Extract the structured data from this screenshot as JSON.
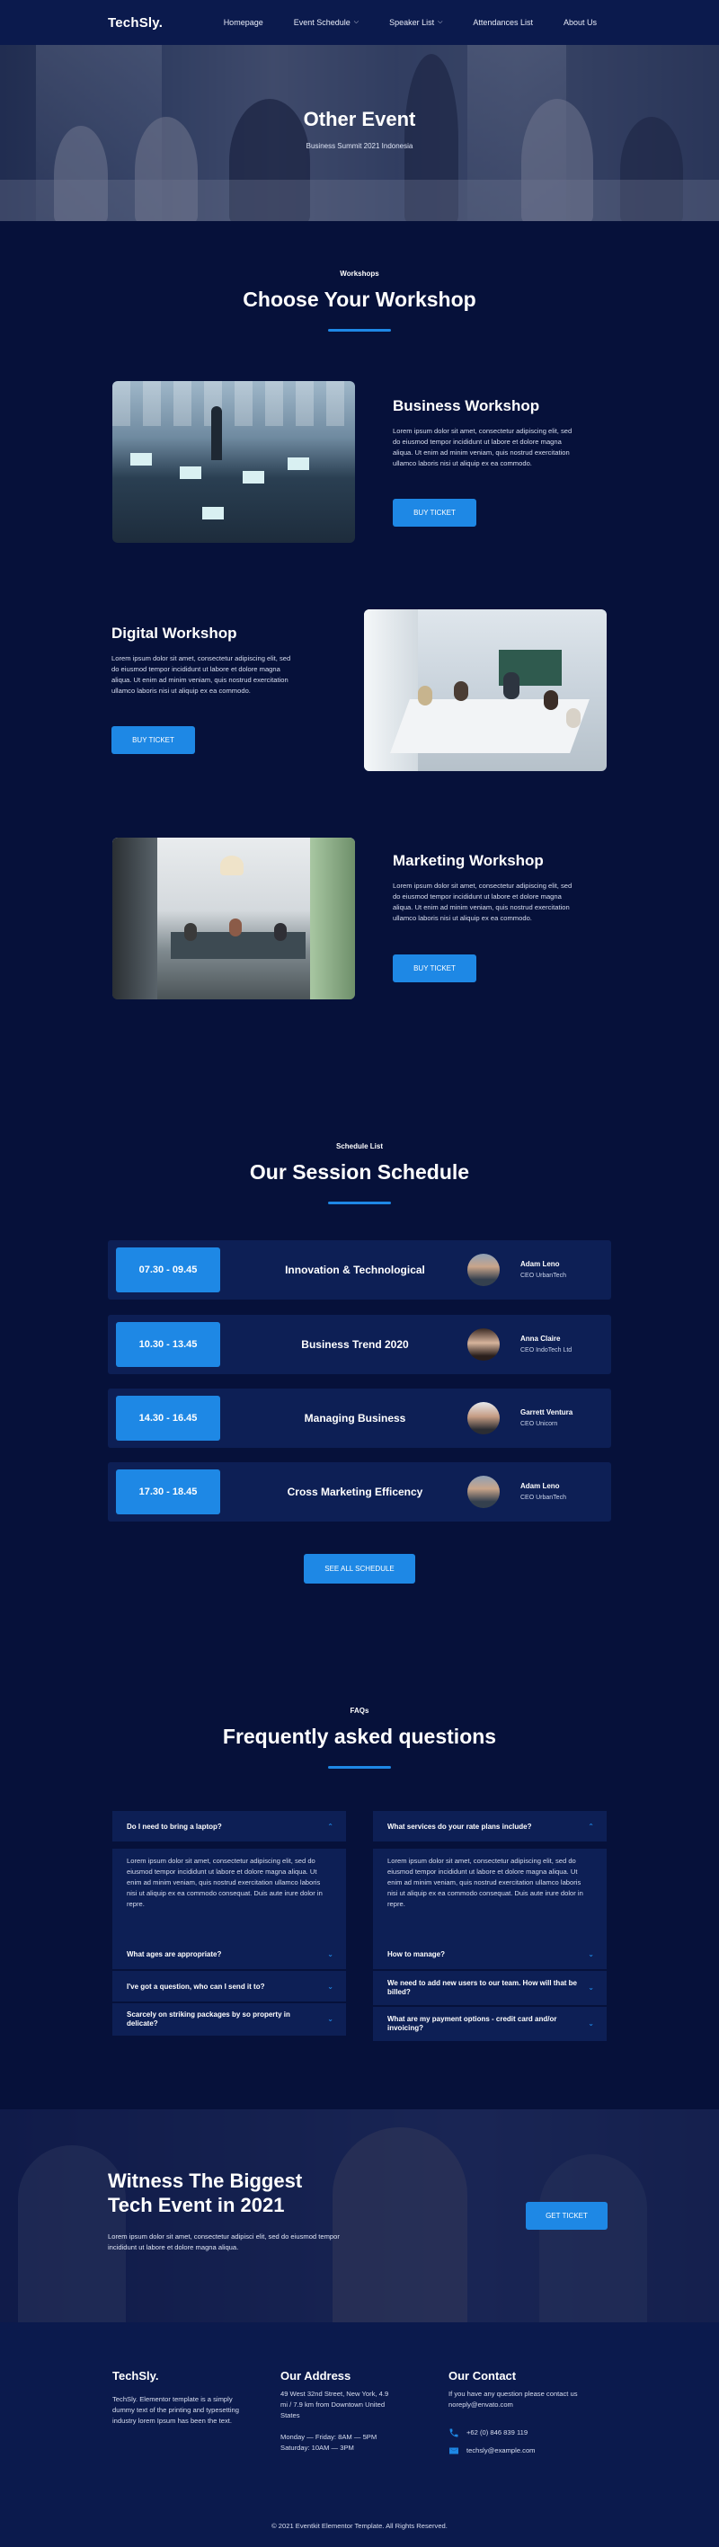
{
  "nav": {
    "logo": "TechSly.",
    "items": [
      {
        "label": "Homepage",
        "dropdown": false
      },
      {
        "label": "Event Schedule",
        "dropdown": true
      },
      {
        "label": "Speaker List",
        "dropdown": true
      },
      {
        "label": "Attendances List",
        "dropdown": false
      },
      {
        "label": "About Us",
        "dropdown": false
      }
    ]
  },
  "hero": {
    "title": "Other Event",
    "subtitle": "Business Summit 2021 Indonesia"
  },
  "workshops": {
    "eyebrow": "Workshops",
    "title": "Choose Your Workshop",
    "items": [
      {
        "title": "Business Workshop",
        "description": "Lorem ipsum dolor sit amet, consectetur adipiscing elit, sed do eiusmod tempor incididunt ut labore et dolore magna aliqua. Ut enim ad minim veniam, quis nostrud exercitation ullamco laboris nisi ut aliquip ex ea commodo.",
        "button": "BUY TICKET"
      },
      {
        "title": "Digital Workshop",
        "description": "Lorem ipsum dolor sit amet, consectetur adipiscing elit, sed do eiusmod tempor incididunt ut labore et dolore magna aliqua. Ut enim ad minim veniam, quis nostrud exercitation ullamco laboris nisi ut aliquip ex ea commodo.",
        "button": "BUY TICKET"
      },
      {
        "title": "Marketing Workshop",
        "description": "Lorem ipsum dolor sit amet, consectetur adipiscing elit, sed do eiusmod tempor incididunt ut labore et dolore magna aliqua. Ut enim ad minim veniam, quis nostrud exercitation ullamco laboris nisi ut aliquip ex ea commodo.",
        "button": "BUY TICKET"
      }
    ]
  },
  "schedule": {
    "eyebrow": "Schedule List",
    "title": "Our Session Schedule",
    "rows": [
      {
        "time": "07.30 - 09.45",
        "topic": "Innovation & Technological",
        "speaker": "Adam Leno",
        "role": "CEO UrbanTech"
      },
      {
        "time": "10.30 - 13.45",
        "topic": "Business Trend 2020",
        "speaker": "Anna Claire",
        "role": "CEO IndoTech Ltd"
      },
      {
        "time": "14.30 - 16.45",
        "topic": "Managing Business",
        "speaker": "Garrett Ventura",
        "role": "CEO Unicorn"
      },
      {
        "time": "17.30 - 18.45",
        "topic": "Cross Marketing Efficency",
        "speaker": "Adam Leno",
        "role": "CEO UrbanTech"
      }
    ],
    "button": "SEE ALL SCHEDULE"
  },
  "faq": {
    "eyebrow": "FAQs",
    "title": "Frequently asked questions",
    "left": {
      "open_question": "Do I need to bring a laptop?",
      "answer": "Lorem ipsum dolor sit amet, consectetur adipiscing elit, sed do eiusmod tempor incididunt ut labore et dolore magna aliqua. Ut enim ad minim veniam, quis nostrud exercitation ullamco laboris nisi ut aliquip ex ea commodo consequat. Duis aute irure dolor in repre.",
      "questions": [
        "What ages are appropriate?",
        "I've got a question, who can I send it to?",
        "Scarcely on striking packages by so property in delicate?"
      ]
    },
    "right": {
      "open_question": "What services do your rate plans include?",
      "answer": "Lorem ipsum dolor sit amet, consectetur adipiscing elit, sed do eiusmod tempor incididunt ut labore et dolore magna aliqua. Ut enim ad minim veniam, quis nostrud exercitation ullamco laboris nisi ut aliquip ex ea commodo consequat. Duis aute irure dolor in repre.",
      "questions": [
        "How to manage?",
        "We need to add new users to our team. How will that be billed?",
        "What are my payment options - credit card and/or invoicing?"
      ]
    }
  },
  "cta": {
    "title_line1": "Witness The Biggest",
    "title_line2": "Tech Event in 2021",
    "description": "Lorem ipsum dolor sit amet, consectetur adipisci elit, sed do eiusmod tempor incididunt ut labore et dolore magna aliqua.",
    "button": "GET TICKET"
  },
  "footer": {
    "brand": "TechSly.",
    "brand_text": "TechSly. Elementor template is a simply dummy text of the printing and typesetting industry lorem Ipsum has been the text.",
    "address_title": "Our Address",
    "address": "49 West 32nd Street, New York, 4.9 mi / 7.9 km from Downtown United States",
    "hours1": "Monday — Friday: 8AM — 5PM",
    "hours2": "Saturday: 10AM — 3PM",
    "contact_title": "Our Contact",
    "contact_text": "If you have any question please contact us noreply@envato.com",
    "phone": "+62 (0) 846 839 119",
    "email": "techsly@example.com",
    "copyright": "© 2021 Eventkit Elementor Template. All Rights Reserved."
  },
  "colors": {
    "background": "#06113a",
    "nav": "#0b1a4d",
    "card": "#0d1f55",
    "accent": "#1e88e5"
  },
  "icons": [
    "chevron-down-icon",
    "chevron-up-icon",
    "phone-icon",
    "email-icon"
  ]
}
